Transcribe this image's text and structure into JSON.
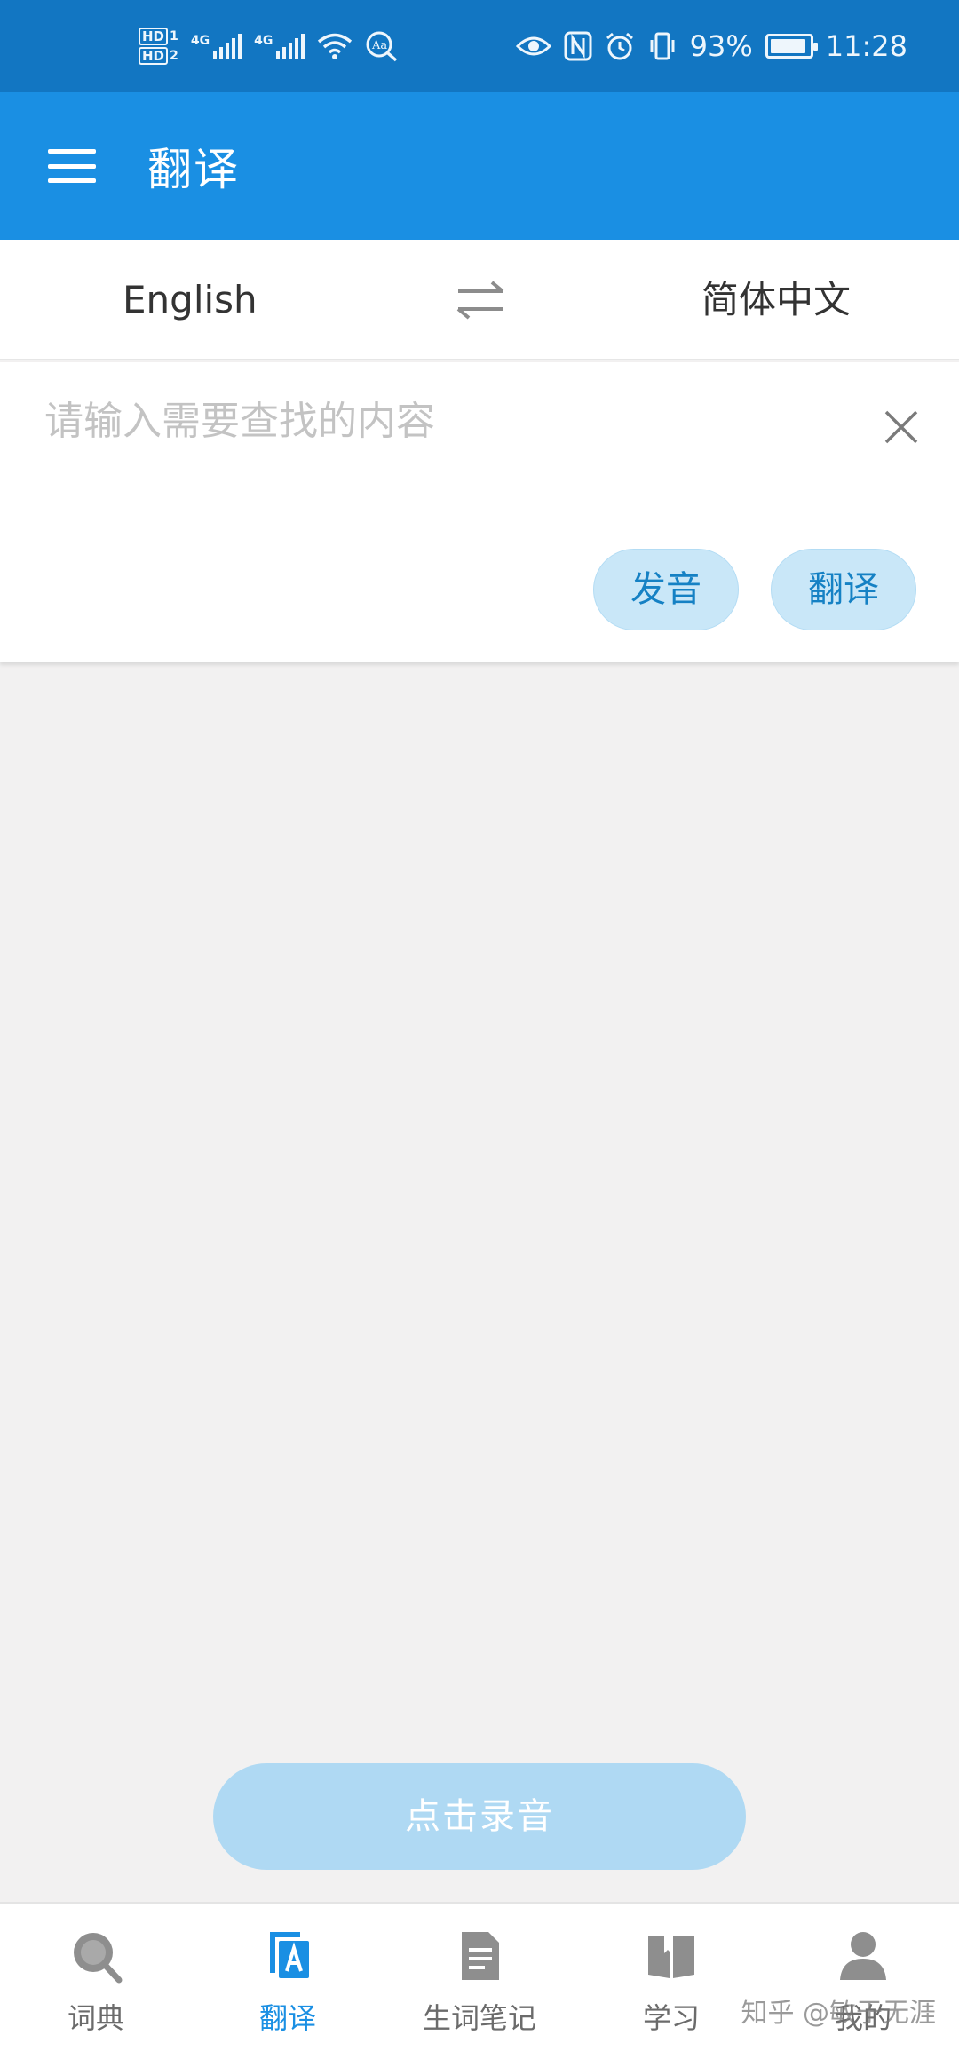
{
  "status_bar": {
    "hd1": "HD",
    "hd1_sub": "1",
    "hd2": "HD",
    "hd2_sub": "2",
    "net1": "4G",
    "net2": "4G",
    "battery_percent": "93%",
    "battery_level": 0.93,
    "time": "11:28",
    "icons": [
      "hd-icon",
      "signal-icon",
      "signal-icon",
      "wifi-icon",
      "text-size-icon",
      "eye-icon",
      "nfc-icon",
      "alarm-icon",
      "vibrate-icon",
      "battery-icon"
    ]
  },
  "app_bar": {
    "title": "翻译",
    "menu_icon": "hamburger-menu-icon"
  },
  "languages": {
    "source": "English",
    "target": "简体中文",
    "swap_icon": "swap-arrows-icon"
  },
  "input": {
    "placeholder": "请输入需要查找的内容",
    "value": "",
    "clear_icon": "close-icon"
  },
  "actions": {
    "speak_label": "发音",
    "translate_label": "翻译"
  },
  "record": {
    "label": "点击录音"
  },
  "tabs": [
    {
      "label": "词典",
      "icon": "search-icon",
      "active": false
    },
    {
      "label": "翻译",
      "icon": "translate-icon",
      "active": true
    },
    {
      "label": "生词笔记",
      "icon": "notebook-icon",
      "active": false
    },
    {
      "label": "学习",
      "icon": "book-icon",
      "active": false
    },
    {
      "label": "我的",
      "icon": "user-icon",
      "active": false
    }
  ],
  "watermark": "知乎 @敏于无涯",
  "colors": {
    "status_bar": "#1276c2",
    "app_bar": "#1a8fe3",
    "pill_bg": "#c9e7f8",
    "pill_text": "#1581c4",
    "record_bg": "#afd9f3",
    "tab_active": "#1a8fe3",
    "tab_inactive": "#6b6b6b",
    "page_bg": "#f2f1f1"
  }
}
